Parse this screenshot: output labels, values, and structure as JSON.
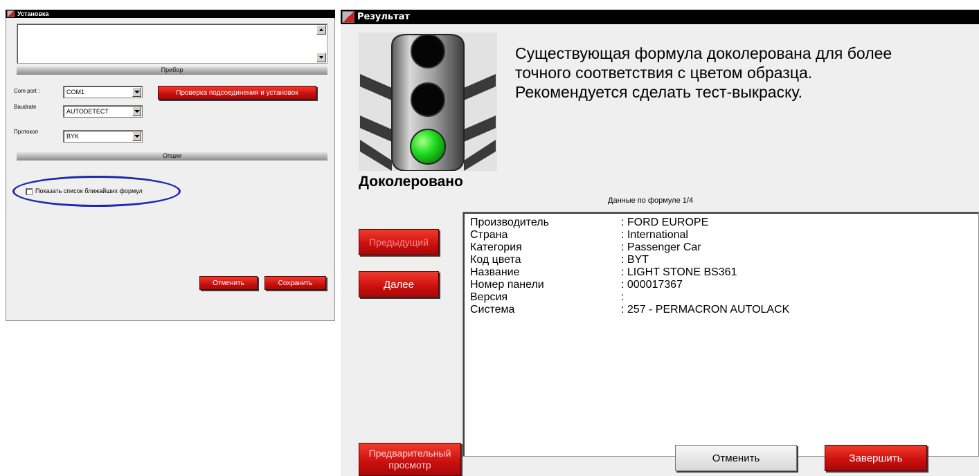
{
  "setup": {
    "title": "Установка",
    "section_device": "Прибор",
    "com_port_label": "Com port :",
    "com_port_value": "COM1",
    "baudrate_label": "Baudrate",
    "baudrate_value": "AUTODETECT",
    "protocol_label": "Протокол",
    "protocol_value": "BYK",
    "check_button": "Проверка подсоединения и установок",
    "section_options": "Опции",
    "show_nearest_label": "Показать список ближайших формул",
    "show_nearest_checked": false,
    "cancel_button": "Отменить",
    "save_button": "Сохранить"
  },
  "result": {
    "title": "Результат",
    "message": "Существующая формула доколерована для более точного соответствия с цветом образца. Рекомендуется сделать тест-выкраску.",
    "status_label": "Доколеровано",
    "formula_header": "Данные по формуле 1/4",
    "traffic_light_active": "green",
    "prev_button": "Предыдущий",
    "next_button": "Далее",
    "rows": [
      {
        "key": "Производитель",
        "value": ": FORD EUROPE"
      },
      {
        "key": "Страна",
        "value": ": International"
      },
      {
        "key": "Категория",
        "value": ": Passenger Car"
      },
      {
        "key": "Код цвета",
        "value": ": BYT"
      },
      {
        "key": "Название",
        "value": ": LIGHT STONE BS361"
      },
      {
        "key": "Номер панели",
        "value": ": 000017367"
      },
      {
        "key": "Версия",
        "value": ":"
      },
      {
        "key": "Система",
        "value": ": 257 - PERMACRON AUTOLACK"
      }
    ],
    "preview_button_line1": "Предварительный",
    "preview_button_line2": "просмотр",
    "cancel_button": "Отменить",
    "finish_button": "Завершить"
  },
  "colors": {
    "accent_red": "#d01010",
    "highlight_ellipse": "#1c2aa8",
    "green_light": "#22dd22"
  }
}
